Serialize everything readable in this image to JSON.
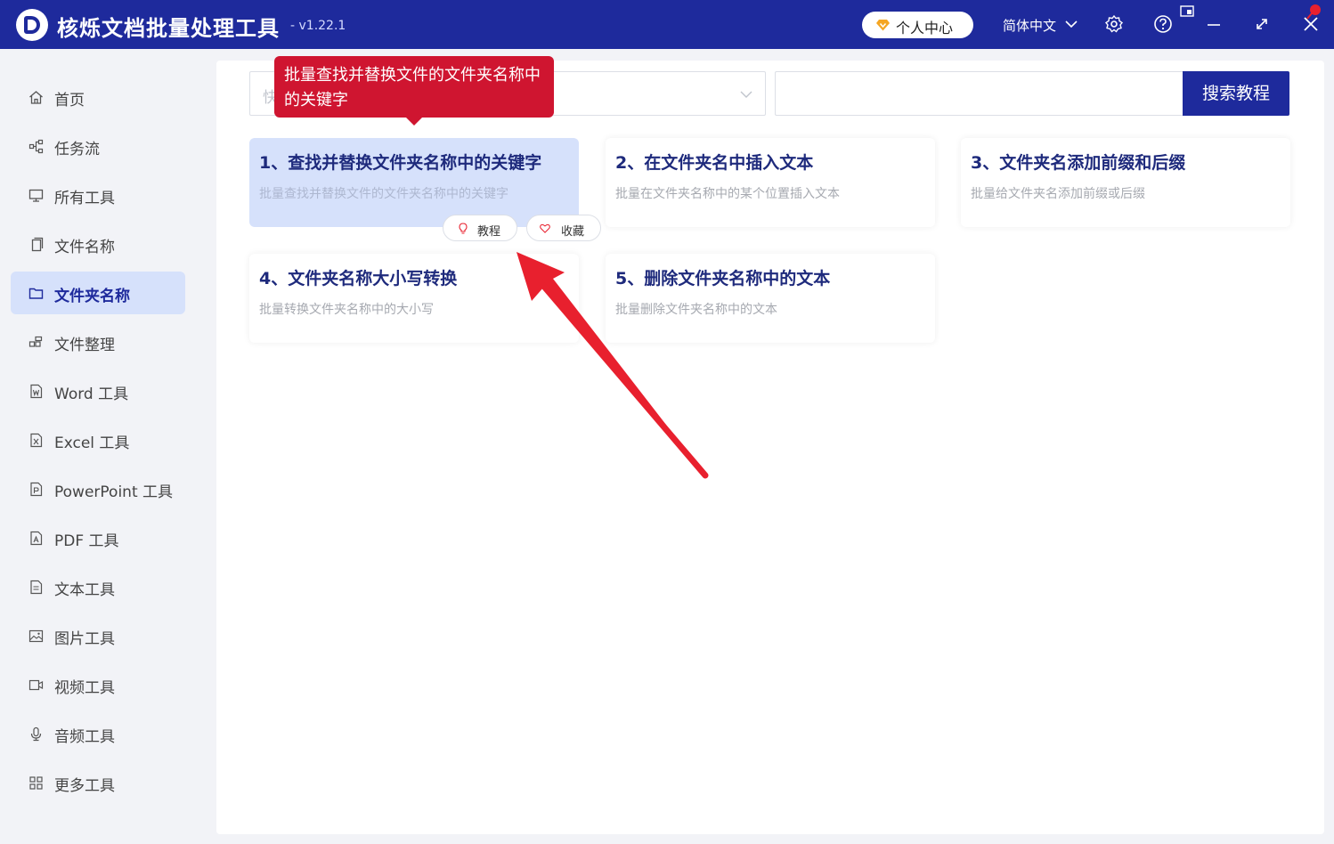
{
  "app": {
    "title": "核烁文档批量处理工具",
    "version": "- v1.22.1"
  },
  "header": {
    "personal_center": "个人中心",
    "language": "简体中文"
  },
  "sidebar": {
    "items": [
      {
        "label": "首页",
        "icon": "home-icon"
      },
      {
        "label": "任务流",
        "icon": "workflow-icon"
      },
      {
        "label": "所有工具",
        "icon": "monitor-icon"
      },
      {
        "label": "文件名称",
        "icon": "file-copy-icon"
      },
      {
        "label": "文件夹名称",
        "icon": "folder-icon",
        "active": true
      },
      {
        "label": "文件整理",
        "icon": "organize-icon"
      },
      {
        "label": "Word 工具",
        "icon": "word-icon"
      },
      {
        "label": "Excel 工具",
        "icon": "excel-icon"
      },
      {
        "label": "PowerPoint 工具",
        "icon": "ppt-icon"
      },
      {
        "label": "PDF 工具",
        "icon": "pdf-icon"
      },
      {
        "label": "文本工具",
        "icon": "text-icon"
      },
      {
        "label": "图片工具",
        "icon": "image-icon"
      },
      {
        "label": "视频工具",
        "icon": "video-icon"
      },
      {
        "label": "音频工具",
        "icon": "mic-icon"
      },
      {
        "label": "更多工具",
        "icon": "grid-icon"
      }
    ]
  },
  "search": {
    "quick_placeholder": "快",
    "button": "搜索教程"
  },
  "tooltip": {
    "text": "批量查找并替换文件的文件夹名称中的关键字"
  },
  "cards": [
    {
      "title": "1、查找并替换文件夹名称中的关键字",
      "desc": "批量查找并替换文件的文件夹名称中的关键字"
    },
    {
      "title": "2、在文件夹名中插入文本",
      "desc": "批量在文件夹名称中的某个位置插入文本"
    },
    {
      "title": "3、文件夹名添加前缀和后缀",
      "desc": "批量给文件夹名添加前缀或后缀"
    },
    {
      "title": "4、文件夹名称大小写转换",
      "desc": "批量转换文件夹名称中的大小写"
    },
    {
      "title": "5、删除文件夹名称中的文本",
      "desc": "批量删除文件夹名称中的文本"
    }
  ],
  "card_actions": {
    "tutorial": "教程",
    "favorite": "收藏"
  },
  "colors": {
    "brand": "#1e2a9c",
    "active_bg": "#d6e1fb",
    "tooltip": "#cf1530",
    "arrow": "#e8202e"
  }
}
